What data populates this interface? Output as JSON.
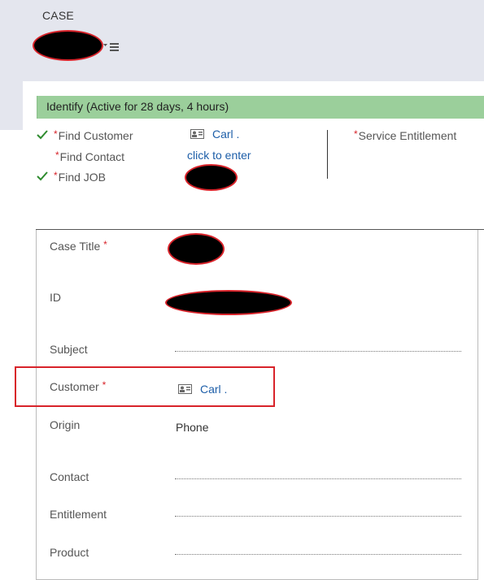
{
  "header": {
    "entity": "CASE"
  },
  "process": {
    "stage_label": "Identify (Active for 28 days, 4 hours)",
    "left_steps": [
      {
        "label": "Find Customer",
        "required": "*",
        "completed": true
      },
      {
        "label": "Find Contact",
        "required": "*",
        "completed": false
      },
      {
        "label": "Find JOB",
        "required": "*",
        "completed": true
      }
    ],
    "customer_value": "Carl .",
    "contact_value": "click to enter",
    "right_step": {
      "label": "Service Entitlement",
      "required": "*"
    }
  },
  "form": {
    "required_marker": "*",
    "case_title_label": "Case Title",
    "id_label": "ID",
    "subject_label": "Subject",
    "customer_label": "Customer",
    "customer_value": "Carl .",
    "origin_label": "Origin",
    "origin_value": "Phone",
    "contact_label": "Contact",
    "entitlement_label": "Entitlement",
    "product_label": "Product"
  },
  "colors": {
    "stage_bar": "#9bcf9b",
    "link": "#1d5ea8",
    "required": "#d8232a",
    "highlight": "#d8232a",
    "check": "#2e8b2e"
  },
  "icons": {
    "check": "check-icon",
    "card": "contact-card-icon",
    "menu": "list-menu-icon"
  }
}
